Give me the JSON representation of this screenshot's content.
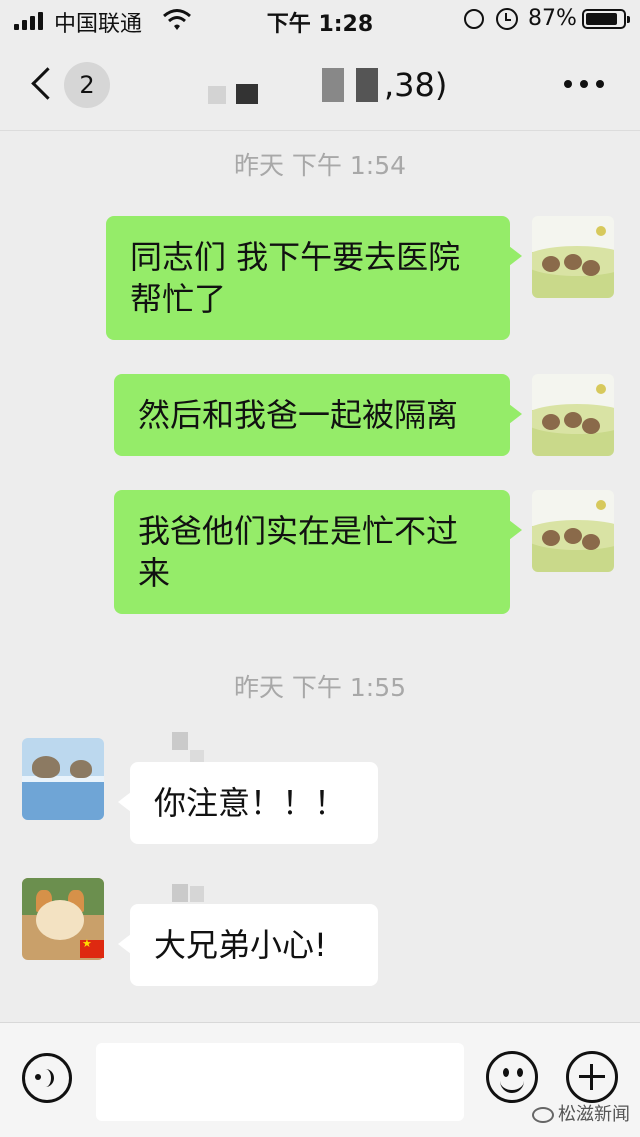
{
  "status_bar": {
    "carrier": "中国联通",
    "time": "下午 1:28",
    "battery": "87%",
    "battery_level": 0.87
  },
  "nav": {
    "unread_count": "2",
    "title_suffix": ",38)"
  },
  "messages": [
    {
      "type": "timestamp",
      "text": "昨天 下午 1:54"
    },
    {
      "type": "sent",
      "lines": [
        "同志们 我下午要去医院",
        "帮忙了"
      ]
    },
    {
      "type": "sent",
      "lines": [
        "然后和我爸一起被隔离"
      ]
    },
    {
      "type": "sent",
      "lines": [
        "我爸他们实在是忙不过",
        "来"
      ]
    },
    {
      "type": "timestamp",
      "text": "昨天 下午 1:55"
    },
    {
      "type": "received",
      "text": "你注意！！！"
    },
    {
      "type": "received",
      "text": "大兄弟小心!"
    }
  ],
  "input_bar": {
    "placeholder": ""
  },
  "icons": {
    "back": "chevron-left-icon",
    "more": "ellipsis-icon",
    "voice": "voice-icon",
    "emoji": "emoji-icon",
    "plus": "plus-icon"
  },
  "watermark": "松滋新闻",
  "colors": {
    "sent_bubble": "#95ec69",
    "received_bubble": "#ffffff",
    "background": "#ededed"
  }
}
